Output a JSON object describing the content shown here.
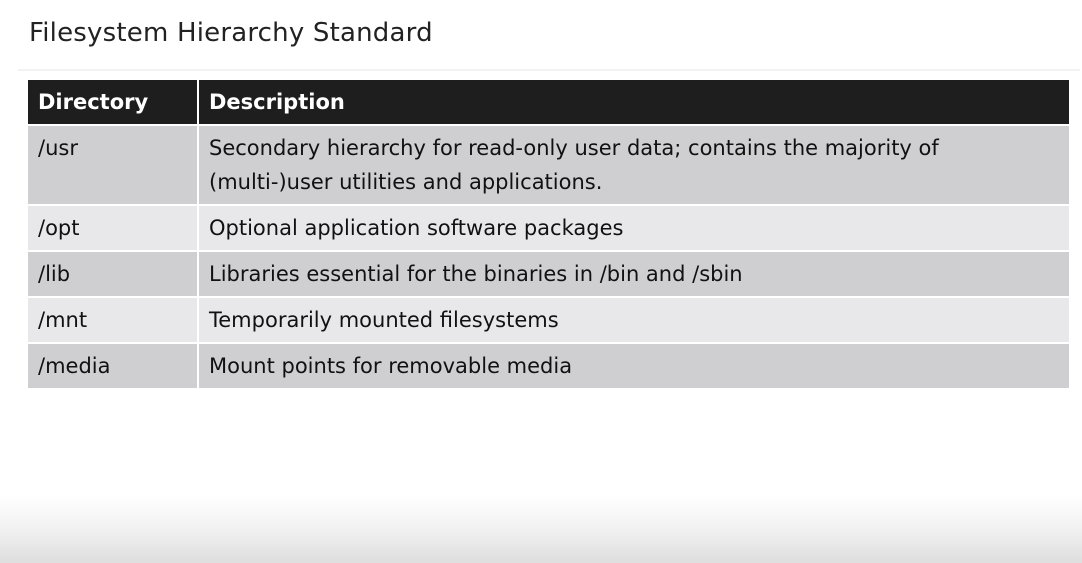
{
  "slide": {
    "title": "Filesystem Hierarchy Standard"
  },
  "table": {
    "headers": {
      "directory": "Directory",
      "description": "Description"
    },
    "rows": [
      {
        "directory": "/usr",
        "description": "Secondary hierarchy for read-only user data; contains the majority of (multi-)user utilities and applications."
      },
      {
        "directory": "/opt",
        "description": "Optional application software packages"
      },
      {
        "directory": "/lib",
        "description": "Libraries essential for the binaries in /bin and /sbin"
      },
      {
        "directory": "/mnt",
        "description": "Temporarily mounted filesystems"
      },
      {
        "directory": "/media",
        "description": "Mount points for removable media"
      }
    ]
  }
}
